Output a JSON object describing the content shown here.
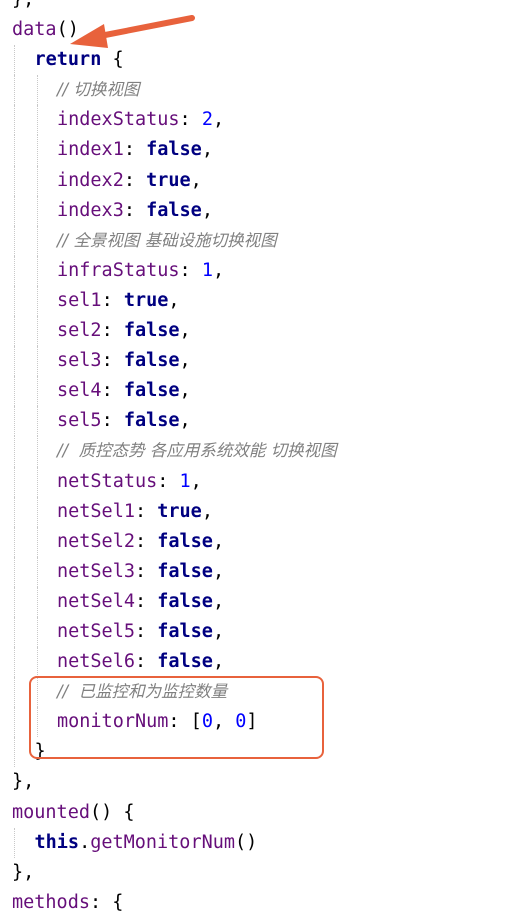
{
  "editor": {
    "lines": [
      {
        "indent": 0,
        "tokens": [
          {
            "t": "},",
            "c": "punc"
          }
        ]
      },
      {
        "indent": 0,
        "tokens": [
          {
            "t": "data",
            "c": "key"
          },
          {
            "t": "()",
            "c": "punc"
          }
        ]
      },
      {
        "indent": 1,
        "tokens": [
          {
            "t": "return",
            "c": "kw"
          },
          {
            "t": " {",
            "c": "punc"
          }
        ]
      },
      {
        "indent": 2,
        "tokens": [
          {
            "t": "// 切换视图",
            "c": "comment"
          }
        ]
      },
      {
        "indent": 2,
        "tokens": [
          {
            "t": "indexStatus",
            "c": "key"
          },
          {
            "t": ": ",
            "c": "punc"
          },
          {
            "t": "2",
            "c": "num"
          },
          {
            "t": ",",
            "c": "punc"
          }
        ]
      },
      {
        "indent": 2,
        "tokens": [
          {
            "t": "index1",
            "c": "key"
          },
          {
            "t": ": ",
            "c": "punc"
          },
          {
            "t": "false",
            "c": "kw"
          },
          {
            "t": ",",
            "c": "punc"
          }
        ]
      },
      {
        "indent": 2,
        "tokens": [
          {
            "t": "index2",
            "c": "key"
          },
          {
            "t": ": ",
            "c": "punc"
          },
          {
            "t": "true",
            "c": "kw"
          },
          {
            "t": ",",
            "c": "punc"
          }
        ]
      },
      {
        "indent": 2,
        "tokens": [
          {
            "t": "index3",
            "c": "key"
          },
          {
            "t": ": ",
            "c": "punc"
          },
          {
            "t": "false",
            "c": "kw"
          },
          {
            "t": ",",
            "c": "punc"
          }
        ]
      },
      {
        "indent": 2,
        "tokens": [
          {
            "t": "// 全景视图 基础设施切换视图",
            "c": "comment"
          }
        ]
      },
      {
        "indent": 2,
        "tokens": [
          {
            "t": "infraStatus",
            "c": "key"
          },
          {
            "t": ": ",
            "c": "punc"
          },
          {
            "t": "1",
            "c": "num"
          },
          {
            "t": ",",
            "c": "punc"
          }
        ]
      },
      {
        "indent": 2,
        "tokens": [
          {
            "t": "sel1",
            "c": "key"
          },
          {
            "t": ": ",
            "c": "punc"
          },
          {
            "t": "true",
            "c": "kw"
          },
          {
            "t": ",",
            "c": "punc"
          }
        ]
      },
      {
        "indent": 2,
        "tokens": [
          {
            "t": "sel2",
            "c": "key"
          },
          {
            "t": ": ",
            "c": "punc"
          },
          {
            "t": "false",
            "c": "kw"
          },
          {
            "t": ",",
            "c": "punc"
          }
        ]
      },
      {
        "indent": 2,
        "tokens": [
          {
            "t": "sel3",
            "c": "key"
          },
          {
            "t": ": ",
            "c": "punc"
          },
          {
            "t": "false",
            "c": "kw"
          },
          {
            "t": ",",
            "c": "punc"
          }
        ]
      },
      {
        "indent": 2,
        "tokens": [
          {
            "t": "sel4",
            "c": "key"
          },
          {
            "t": ": ",
            "c": "punc"
          },
          {
            "t": "false",
            "c": "kw"
          },
          {
            "t": ",",
            "c": "punc"
          }
        ]
      },
      {
        "indent": 2,
        "tokens": [
          {
            "t": "sel5",
            "c": "key"
          },
          {
            "t": ": ",
            "c": "punc"
          },
          {
            "t": "false",
            "c": "kw"
          },
          {
            "t": ",",
            "c": "punc"
          }
        ]
      },
      {
        "indent": 2,
        "tokens": [
          {
            "t": "//  质控态势 各应用系统效能 切换视图",
            "c": "comment"
          }
        ]
      },
      {
        "indent": 2,
        "tokens": [
          {
            "t": "netStatus",
            "c": "key"
          },
          {
            "t": ": ",
            "c": "punc"
          },
          {
            "t": "1",
            "c": "num"
          },
          {
            "t": ",",
            "c": "punc"
          }
        ]
      },
      {
        "indent": 2,
        "tokens": [
          {
            "t": "netSel1",
            "c": "key"
          },
          {
            "t": ": ",
            "c": "punc"
          },
          {
            "t": "true",
            "c": "kw"
          },
          {
            "t": ",",
            "c": "punc"
          }
        ]
      },
      {
        "indent": 2,
        "tokens": [
          {
            "t": "netSel2",
            "c": "key"
          },
          {
            "t": ": ",
            "c": "punc"
          },
          {
            "t": "false",
            "c": "kw"
          },
          {
            "t": ",",
            "c": "punc"
          }
        ]
      },
      {
        "indent": 2,
        "tokens": [
          {
            "t": "netSel3",
            "c": "key"
          },
          {
            "t": ": ",
            "c": "punc"
          },
          {
            "t": "false",
            "c": "kw"
          },
          {
            "t": ",",
            "c": "punc"
          }
        ]
      },
      {
        "indent": 2,
        "tokens": [
          {
            "t": "netSel4",
            "c": "key"
          },
          {
            "t": ": ",
            "c": "punc"
          },
          {
            "t": "false",
            "c": "kw"
          },
          {
            "t": ",",
            "c": "punc"
          }
        ]
      },
      {
        "indent": 2,
        "tokens": [
          {
            "t": "netSel5",
            "c": "key"
          },
          {
            "t": ": ",
            "c": "punc"
          },
          {
            "t": "false",
            "c": "kw"
          },
          {
            "t": ",",
            "c": "punc"
          }
        ]
      },
      {
        "indent": 2,
        "tokens": [
          {
            "t": "netSel6",
            "c": "key"
          },
          {
            "t": ": ",
            "c": "punc"
          },
          {
            "t": "false",
            "c": "kw"
          },
          {
            "t": ",",
            "c": "punc"
          }
        ]
      },
      {
        "indent": 2,
        "tokens": [
          {
            "t": "//  已监控和为监控数量",
            "c": "comment"
          }
        ]
      },
      {
        "indent": 2,
        "tokens": [
          {
            "t": "monitorNum",
            "c": "key"
          },
          {
            "t": ": [",
            "c": "punc"
          },
          {
            "t": "0",
            "c": "num"
          },
          {
            "t": ", ",
            "c": "punc"
          },
          {
            "t": "0",
            "c": "num"
          },
          {
            "t": "]",
            "c": "punc"
          }
        ]
      },
      {
        "indent": 1,
        "tokens": [
          {
            "t": "}",
            "c": "punc"
          }
        ]
      },
      {
        "indent": 0,
        "tokens": [
          {
            "t": "},",
            "c": "punc"
          }
        ]
      },
      {
        "indent": 0,
        "tokens": [
          {
            "t": "mounted",
            "c": "key"
          },
          {
            "t": "() {",
            "c": "punc"
          }
        ]
      },
      {
        "indent": 1,
        "tokens": [
          {
            "t": "this",
            "c": "kw"
          },
          {
            "t": ".",
            "c": "punc"
          },
          {
            "t": "getMonitorNum",
            "c": "method"
          },
          {
            "t": "()",
            "c": "punc"
          }
        ]
      },
      {
        "indent": 0,
        "tokens": [
          {
            "t": "},",
            "c": "punc"
          }
        ]
      },
      {
        "indent": 0,
        "tokens": [
          {
            "t": "methods",
            "c": "key"
          },
          {
            "t": ": {",
            "c": "punc"
          }
        ]
      }
    ]
  },
  "annotations": {
    "arrow_color": "#e8623c",
    "box_color": "#e8623c"
  }
}
